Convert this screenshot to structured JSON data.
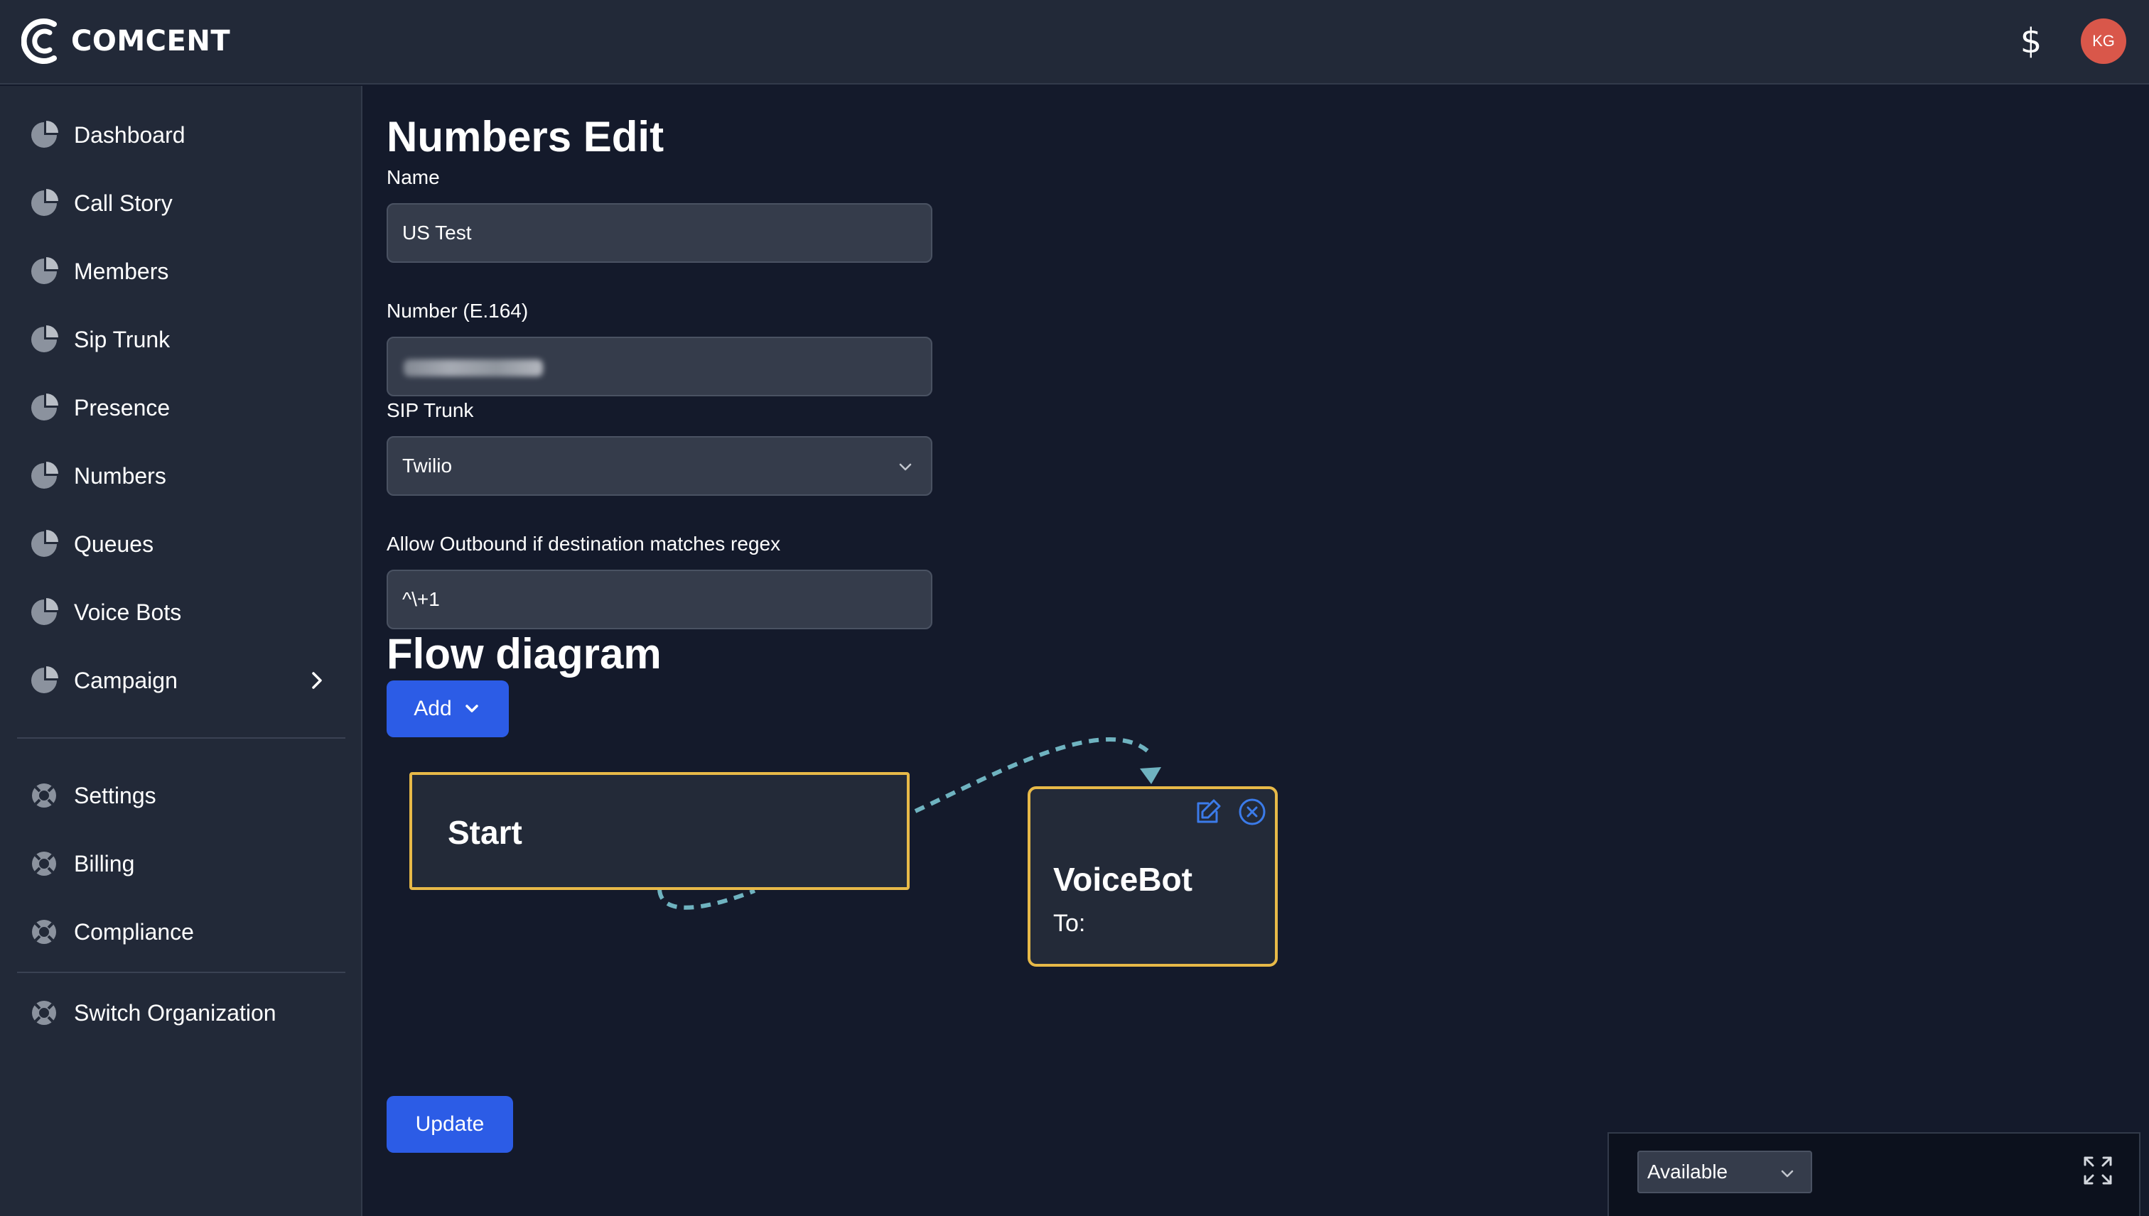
{
  "header": {
    "logo_text": "COMCENT",
    "avatar_initials": "KG",
    "dollar_symbol": "$",
    "colors": {
      "bar": "#222938",
      "avatar": "#d9574a"
    }
  },
  "sidebar": {
    "items": [
      {
        "label": "Dashboard",
        "icon": "pie-chart-icon"
      },
      {
        "label": "Call Story",
        "icon": "pie-chart-icon"
      },
      {
        "label": "Members",
        "icon": "pie-chart-icon"
      },
      {
        "label": "Sip Trunk",
        "icon": "pie-chart-icon"
      },
      {
        "label": "Presence",
        "icon": "pie-chart-icon"
      },
      {
        "label": "Numbers",
        "icon": "pie-chart-icon"
      },
      {
        "label": "Queues",
        "icon": "pie-chart-icon"
      },
      {
        "label": "Voice Bots",
        "icon": "pie-chart-icon"
      },
      {
        "label": "Campaign",
        "icon": "pie-chart-icon"
      }
    ],
    "settings_items": [
      {
        "label": "Settings",
        "icon": "lifebuoy-icon"
      },
      {
        "label": "Billing",
        "icon": "lifebuoy-icon"
      },
      {
        "label": "Compliance",
        "icon": "lifebuoy-icon"
      }
    ],
    "org_item": {
      "label": "Switch Organization",
      "icon": "lifebuoy-icon"
    }
  },
  "main": {
    "title": "Numbers Edit",
    "name_label": "Name",
    "name_value": "US Test",
    "number_label": "Number (E.164)",
    "sip_trunk_label": "SIP Trunk",
    "sip_trunk_value": "Twilio",
    "regex_label": "Allow Outbound if destination matches regex",
    "regex_value": "^\\+1",
    "flow_title": "Flow diagram",
    "add_button": "Add",
    "update_button": "Update",
    "accent_color": "#2c5ce6"
  },
  "flow": {
    "start_node": {
      "title": "Start"
    },
    "voicebot_node": {
      "title": "VoiceBot",
      "subtitle": "To:"
    },
    "node_border_color": "#e7b948",
    "edge_color": "#6fb3c0"
  },
  "dock": {
    "status_value": "Available"
  }
}
